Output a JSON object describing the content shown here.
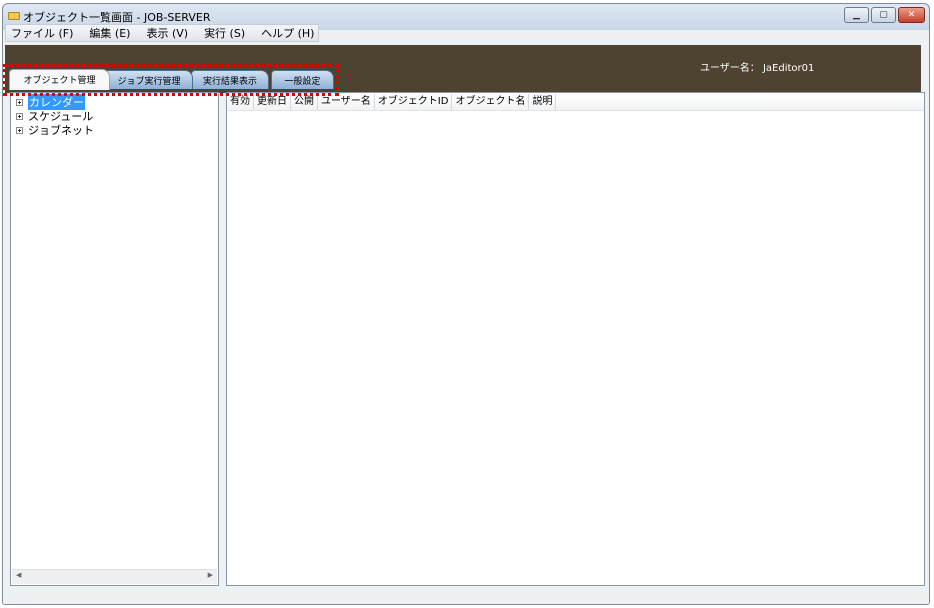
{
  "window": {
    "title": "オブジェクト一覧画面 - JOB-SERVER",
    "controls": [
      "minimize",
      "maximize",
      "close"
    ]
  },
  "menu": {
    "items": [
      {
        "label": "ファイル (F)"
      },
      {
        "label": "編集 (E)"
      },
      {
        "label": "表示 (V)"
      },
      {
        "label": "実行 (S)"
      },
      {
        "label": "ヘルプ (H)"
      }
    ]
  },
  "header": {
    "user_label": "ユーザー名： JaEditor01",
    "band_color": "#4e4330"
  },
  "tabs": [
    {
      "label": "オブジェクト管理",
      "active": true
    },
    {
      "label": "ジョブ実行管理",
      "active": false
    },
    {
      "label": "実行結果表示",
      "active": false
    },
    {
      "label": "一般設定",
      "active": false
    }
  ],
  "annotation": {
    "color": "#e00000",
    "style": "dotted"
  },
  "tree": {
    "nodes": [
      {
        "label": "カレンダー",
        "selected": true
      },
      {
        "label": "スケジュール",
        "selected": false
      },
      {
        "label": "ジョブネット",
        "selected": false
      }
    ]
  },
  "table": {
    "columns": [
      "有効",
      "更新日",
      "公開",
      "ユーザー名",
      "オブジェクトID",
      "オブジェクト名",
      "説明"
    ],
    "rows": []
  }
}
